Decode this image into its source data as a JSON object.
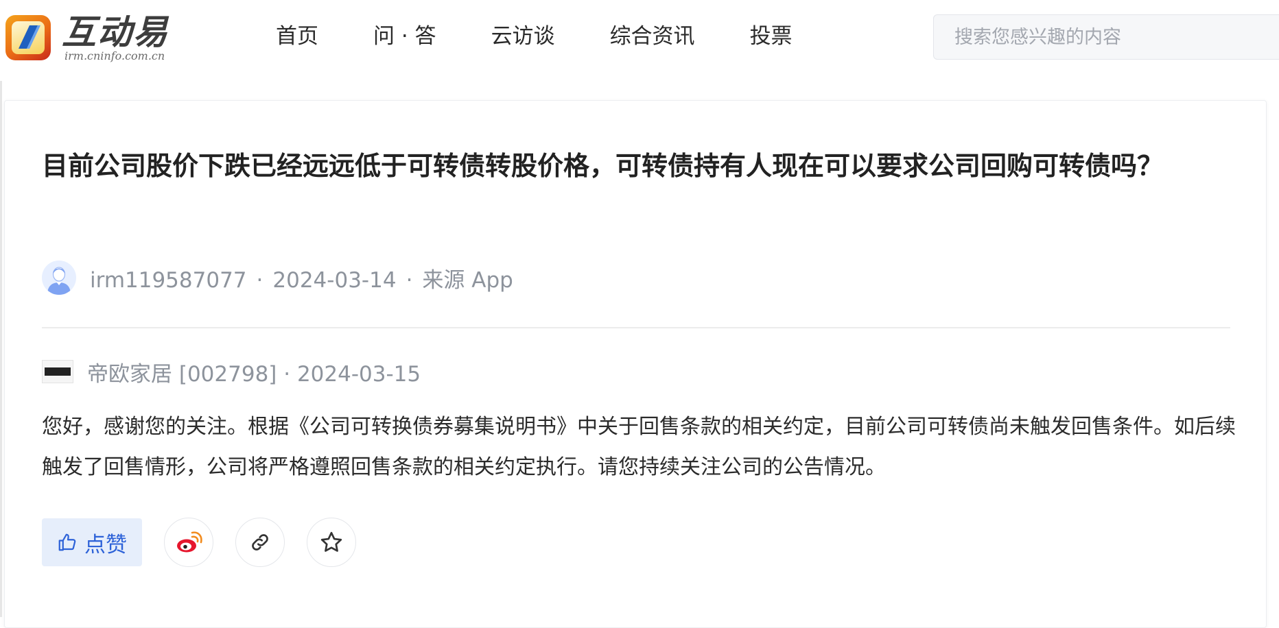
{
  "header": {
    "logo": {
      "name": "互动易",
      "url": "irm.cninfo.com.cn"
    },
    "nav": [
      {
        "label": "首页"
      },
      {
        "label": "问 · 答"
      },
      {
        "label": "云访谈"
      },
      {
        "label": "综合资讯"
      },
      {
        "label": "投票"
      }
    ],
    "search": {
      "placeholder": "搜索您感兴趣的内容",
      "value": ""
    }
  },
  "question": {
    "title": "目前公司股价下跌已经远远低于可转债转股价格，可转债持有人现在可以要求公司回购可转债吗？",
    "asker": "irm119587077",
    "date": "2024-03-14",
    "source": "来源 App",
    "separator": "·"
  },
  "answer": {
    "company": "帝欧家居 [002798]",
    "date": "2024-03-15",
    "body": "您好，感谢您的关注。根据《公司可转换债券募集说明书》中关于回售条款的相关约定，目前公司可转债尚未触发回售条件。如后续触发了回售情形，公司将严格遵照回售条款的相关约定执行。请您持续关注公司的公告情况。"
  },
  "actions": {
    "like_label": "点赞",
    "icons": [
      "thumbs-up-icon",
      "weibo-icon",
      "link-icon",
      "star-icon"
    ]
  },
  "colors": {
    "accent": "#2d62d8",
    "like_bg": "#e6eefb",
    "meta_text": "#8d939c",
    "logo_orange": "#ea6b16"
  }
}
